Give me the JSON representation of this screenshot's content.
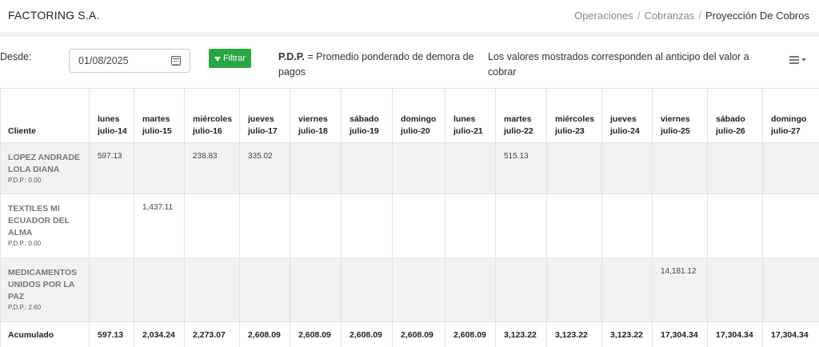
{
  "header": {
    "brand": "FACTORING S.A.",
    "breadcrumb": [
      "Operaciones",
      "Cobranzas",
      "Proyección De Cobros"
    ],
    "separator": "/"
  },
  "filters": {
    "desde_label": "Desde:",
    "date_value": "01/08/2025",
    "filter_button": "Filtrar",
    "pdp_abbr": "P.D.P.",
    "pdp_text": "= Promedio ponderado de demora de pagos",
    "values_note": "Los valores mostrados corresponden al anticipo del valor a cobrar"
  },
  "table": {
    "client_header": "Cliente",
    "columns": [
      {
        "day": "lunes",
        "date": "julio-14"
      },
      {
        "day": "martes",
        "date": "julio-15"
      },
      {
        "day": "miércoles",
        "date": "julio-16"
      },
      {
        "day": "jueves",
        "date": "julio-17"
      },
      {
        "day": "viernes",
        "date": "julio-18"
      },
      {
        "day": "sábado",
        "date": "julio-19"
      },
      {
        "day": "domingo",
        "date": "julio-20"
      },
      {
        "day": "lunes",
        "date": "julio-21"
      },
      {
        "day": "martes",
        "date": "julio-22"
      },
      {
        "day": "miércoles",
        "date": "julio-23"
      },
      {
        "day": "jueves",
        "date": "julio-24"
      },
      {
        "day": "viernes",
        "date": "julio-25"
      },
      {
        "day": "sábado",
        "date": "julio-26"
      },
      {
        "day": "domingo",
        "date": "julio-27"
      }
    ],
    "rows": [
      {
        "client": "LOPEZ ANDRADE LOLA DIANA",
        "pdp": "P.D.P.: 0.00",
        "values": [
          "597.13",
          "",
          "238.83",
          "335.02",
          "",
          "",
          "",
          "",
          "515.13",
          "",
          "",
          "",
          "",
          ""
        ]
      },
      {
        "client": "TEXTILES MI ECUADOR DEL ALMA",
        "pdp": "P.D.P.: 0.00",
        "values": [
          "",
          "1,437.11",
          "",
          "",
          "",
          "",
          "",
          "",
          "",
          "",
          "",
          "",
          "",
          ""
        ]
      },
      {
        "client": "MEDICAMENTOS UNIDOS POR LA PAZ",
        "pdp": "P.D.P.: 2.60",
        "values": [
          "",
          "",
          "",
          "",
          "",
          "",
          "",
          "",
          "",
          "",
          "",
          "14,181.12",
          "",
          ""
        ]
      }
    ],
    "total_label": "Acumulado",
    "totals": [
      "597.13",
      "2,034.24",
      "2,273.07",
      "2,608.09",
      "2,608.09",
      "2,608.09",
      "2,608.09",
      "2,608.09",
      "3,123.22",
      "3,123.22",
      "3,123.22",
      "17,304.34",
      "17,304.34",
      "17,304.34"
    ]
  }
}
